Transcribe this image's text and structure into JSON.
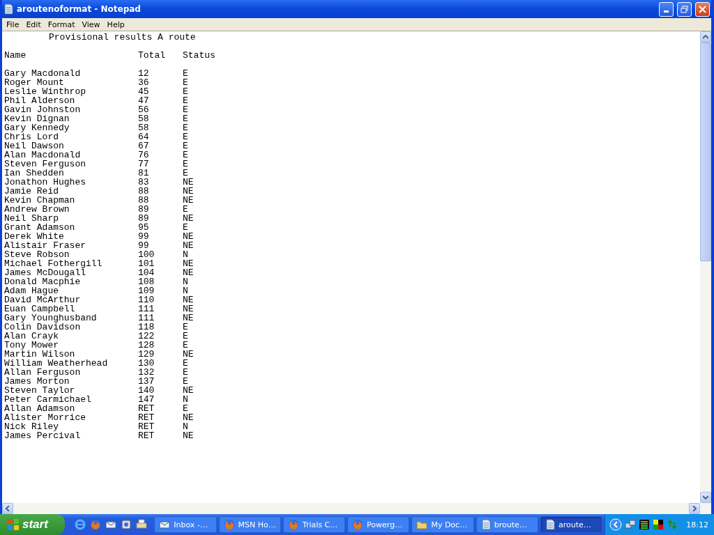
{
  "window": {
    "title": "aroutenoformat - Notepad"
  },
  "menu": [
    "File",
    "Edit",
    "Format",
    "View",
    "Help"
  ],
  "document": {
    "title": "Provisional results A route",
    "columns": [
      "Name",
      "Total",
      "Status"
    ],
    "rows": [
      {
        "name": "Gary Macdonald",
        "total": "12",
        "status": "E"
      },
      {
        "name": "Roger Mount",
        "total": "36",
        "status": "E"
      },
      {
        "name": "Leslie Winthrop",
        "total": "45",
        "status": "E"
      },
      {
        "name": "Phil Alderson",
        "total": "47",
        "status": "E"
      },
      {
        "name": "Gavin Johnston",
        "total": "56",
        "status": "E"
      },
      {
        "name": "Kevin Dignan",
        "total": "58",
        "status": "E"
      },
      {
        "name": "Gary Kennedy",
        "total": "58",
        "status": "E"
      },
      {
        "name": "Chris Lord",
        "total": "64",
        "status": "E"
      },
      {
        "name": "Neil Dawson",
        "total": "67",
        "status": "E"
      },
      {
        "name": "Alan Macdonald",
        "total": "76",
        "status": "E"
      },
      {
        "name": "Steven Ferguson",
        "total": "77",
        "status": "E"
      },
      {
        "name": "Ian Shedden",
        "total": "81",
        "status": "E"
      },
      {
        "name": "Jonathon Hughes",
        "total": "83",
        "status": "NE"
      },
      {
        "name": "Jamie Reid",
        "total": "88",
        "status": "NE"
      },
      {
        "name": "Kevin Chapman",
        "total": "88",
        "status": "NE"
      },
      {
        "name": "Andrew Brown",
        "total": "89",
        "status": "E"
      },
      {
        "name": "Neil Sharp",
        "total": "89",
        "status": "NE"
      },
      {
        "name": "Grant Adamson",
        "total": "95",
        "status": "E"
      },
      {
        "name": "Derek White",
        "total": "99",
        "status": "NE"
      },
      {
        "name": "Alistair Fraser",
        "total": "99",
        "status": "NE"
      },
      {
        "name": "Steve Robson",
        "total": "100",
        "status": "N"
      },
      {
        "name": "Michael Fothergill",
        "total": "101",
        "status": "NE"
      },
      {
        "name": "James McDougall",
        "total": "104",
        "status": "NE"
      },
      {
        "name": "Donald Macphie",
        "total": "108",
        "status": "N"
      },
      {
        "name": "Adam Hague",
        "total": "109",
        "status": "N"
      },
      {
        "name": "David McArthur",
        "total": "110",
        "status": "NE"
      },
      {
        "name": "Euan Campbell",
        "total": "111",
        "status": "NE"
      },
      {
        "name": "Gary Younghusband",
        "total": "111",
        "status": "NE"
      },
      {
        "name": "Colin Davidson",
        "total": "118",
        "status": "E"
      },
      {
        "name": "Alan Crayk",
        "total": "122",
        "status": "E"
      },
      {
        "name": "Tony Mower",
        "total": "128",
        "status": "E"
      },
      {
        "name": "Martin Wilson",
        "total": "129",
        "status": "NE"
      },
      {
        "name": "William Weatherhead",
        "total": "130",
        "status": "E"
      },
      {
        "name": "Allan Ferguson",
        "total": "132",
        "status": "E"
      },
      {
        "name": "James Morton",
        "total": "137",
        "status": "E"
      },
      {
        "name": "Steven Taylor",
        "total": "140",
        "status": "NE"
      },
      {
        "name": "Peter Carmichael",
        "total": "147",
        "status": "N"
      },
      {
        "name": "Allan Adamson",
        "total": "RET",
        "status": "E"
      },
      {
        "name": "Alister Morrice",
        "total": "RET",
        "status": "NE"
      },
      {
        "name": "Nick Riley",
        "total": "RET",
        "status": "N"
      },
      {
        "name": "James Percival",
        "total": "RET",
        "status": "NE"
      }
    ]
  },
  "taskbar": {
    "start": "start",
    "tasks": [
      {
        "label": "Inbox -…",
        "kind": "mail",
        "selected": false
      },
      {
        "label": "MSN Ho…",
        "kind": "browser",
        "selected": false
      },
      {
        "label": "Trials C…",
        "kind": "browser",
        "selected": false
      },
      {
        "label": "Powerg…",
        "kind": "browser",
        "selected": false
      },
      {
        "label": "My Doc…",
        "kind": "folder",
        "selected": false
      },
      {
        "label": "broute…",
        "kind": "notepad",
        "selected": false
      },
      {
        "label": "aroute…",
        "kind": "notepad",
        "selected": true
      }
    ],
    "clock": "18:12"
  }
}
